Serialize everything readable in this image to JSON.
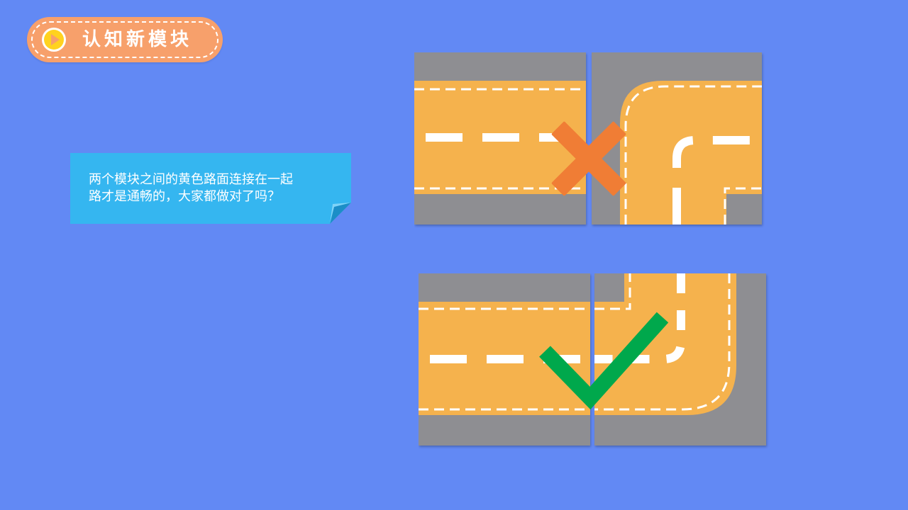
{
  "header": {
    "title": "认知新模块",
    "icon": "play-icon",
    "colors": {
      "pill": "#f7a06b",
      "icon_fill": "#ffd21f",
      "icon_ring": "#ffffff",
      "triangle": "#f7a06b"
    }
  },
  "note": {
    "line1": "两个模块之间的黄色路面连接在一起",
    "line2": "路才是通畅的，大家都做对了吗？",
    "color": "#35b6f0"
  },
  "examples": [
    {
      "name": "wrong-example",
      "mark": "cross-icon",
      "mark_color": "#f07d35"
    },
    {
      "name": "correct-example",
      "mark": "check-icon",
      "mark_color": "#00a84c"
    }
  ],
  "colors": {
    "background": "#6289f4",
    "road": "#f5b24d",
    "curb": "#8e8e92",
    "dash": "#ffffff"
  }
}
